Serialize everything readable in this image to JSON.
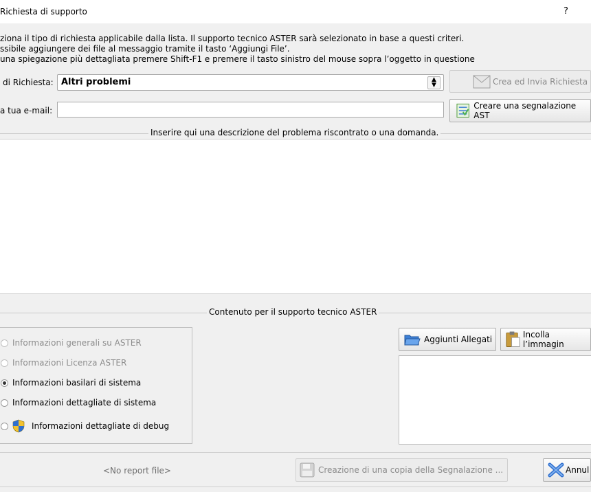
{
  "window": {
    "title": "Richiesta di supporto",
    "help": "?"
  },
  "instructions": [
    "ziona il tipo di richiesta applicabile dalla lista. Il supporto tecnico ASTER sarà selezionato in base a questi criteri.",
    "ssibile aggiungere dei file al messaggio tramite il tasto ‘Aggiungi File’.",
    "una spiegazione più dettagliata premere Shift-F1 e premere il tasto sinistro del mouse sopra l’oggetto in questione"
  ],
  "request_type": {
    "label": "di Richiesta:",
    "value": "Altri problemi"
  },
  "email": {
    "label": "a tua e-mail:",
    "value": ""
  },
  "buttons": {
    "create_send": "Crea ed Invia Richiesta",
    "create_report": "Creare una segnalazione AST",
    "add_attachments": "Aggiunti Allegati",
    "paste_image": "Incolla l’immagin",
    "save_copy": "Creazione di una copia della Segnalazione ...",
    "cancel": "Annul"
  },
  "description_group": {
    "title": "Inserire qui una descrizione del problema riscontrato o una domanda."
  },
  "content_group": {
    "title": "Contenuto per il supporto tecnico ASTER"
  },
  "options": [
    {
      "label": "Informazioni generali su ASTER",
      "enabled": false,
      "selected": false
    },
    {
      "label": "Informazioni Licenza ASTER",
      "enabled": false,
      "selected": false
    },
    {
      "label": "Informazioni basilari di sistema",
      "enabled": true,
      "selected": true
    },
    {
      "label": "Informazioni dettagliate di sistema",
      "enabled": true,
      "selected": false
    },
    {
      "label": "Informazioni dettagliate di debug",
      "enabled": true,
      "selected": false,
      "icon": "uac-shield-icon"
    }
  ],
  "status": {
    "report_file": "<No report file>"
  },
  "colors": {
    "accent_blue": "#3c7fd1",
    "shield_yellow": "#f2c230",
    "cancel_x": "#2f6fcf"
  }
}
